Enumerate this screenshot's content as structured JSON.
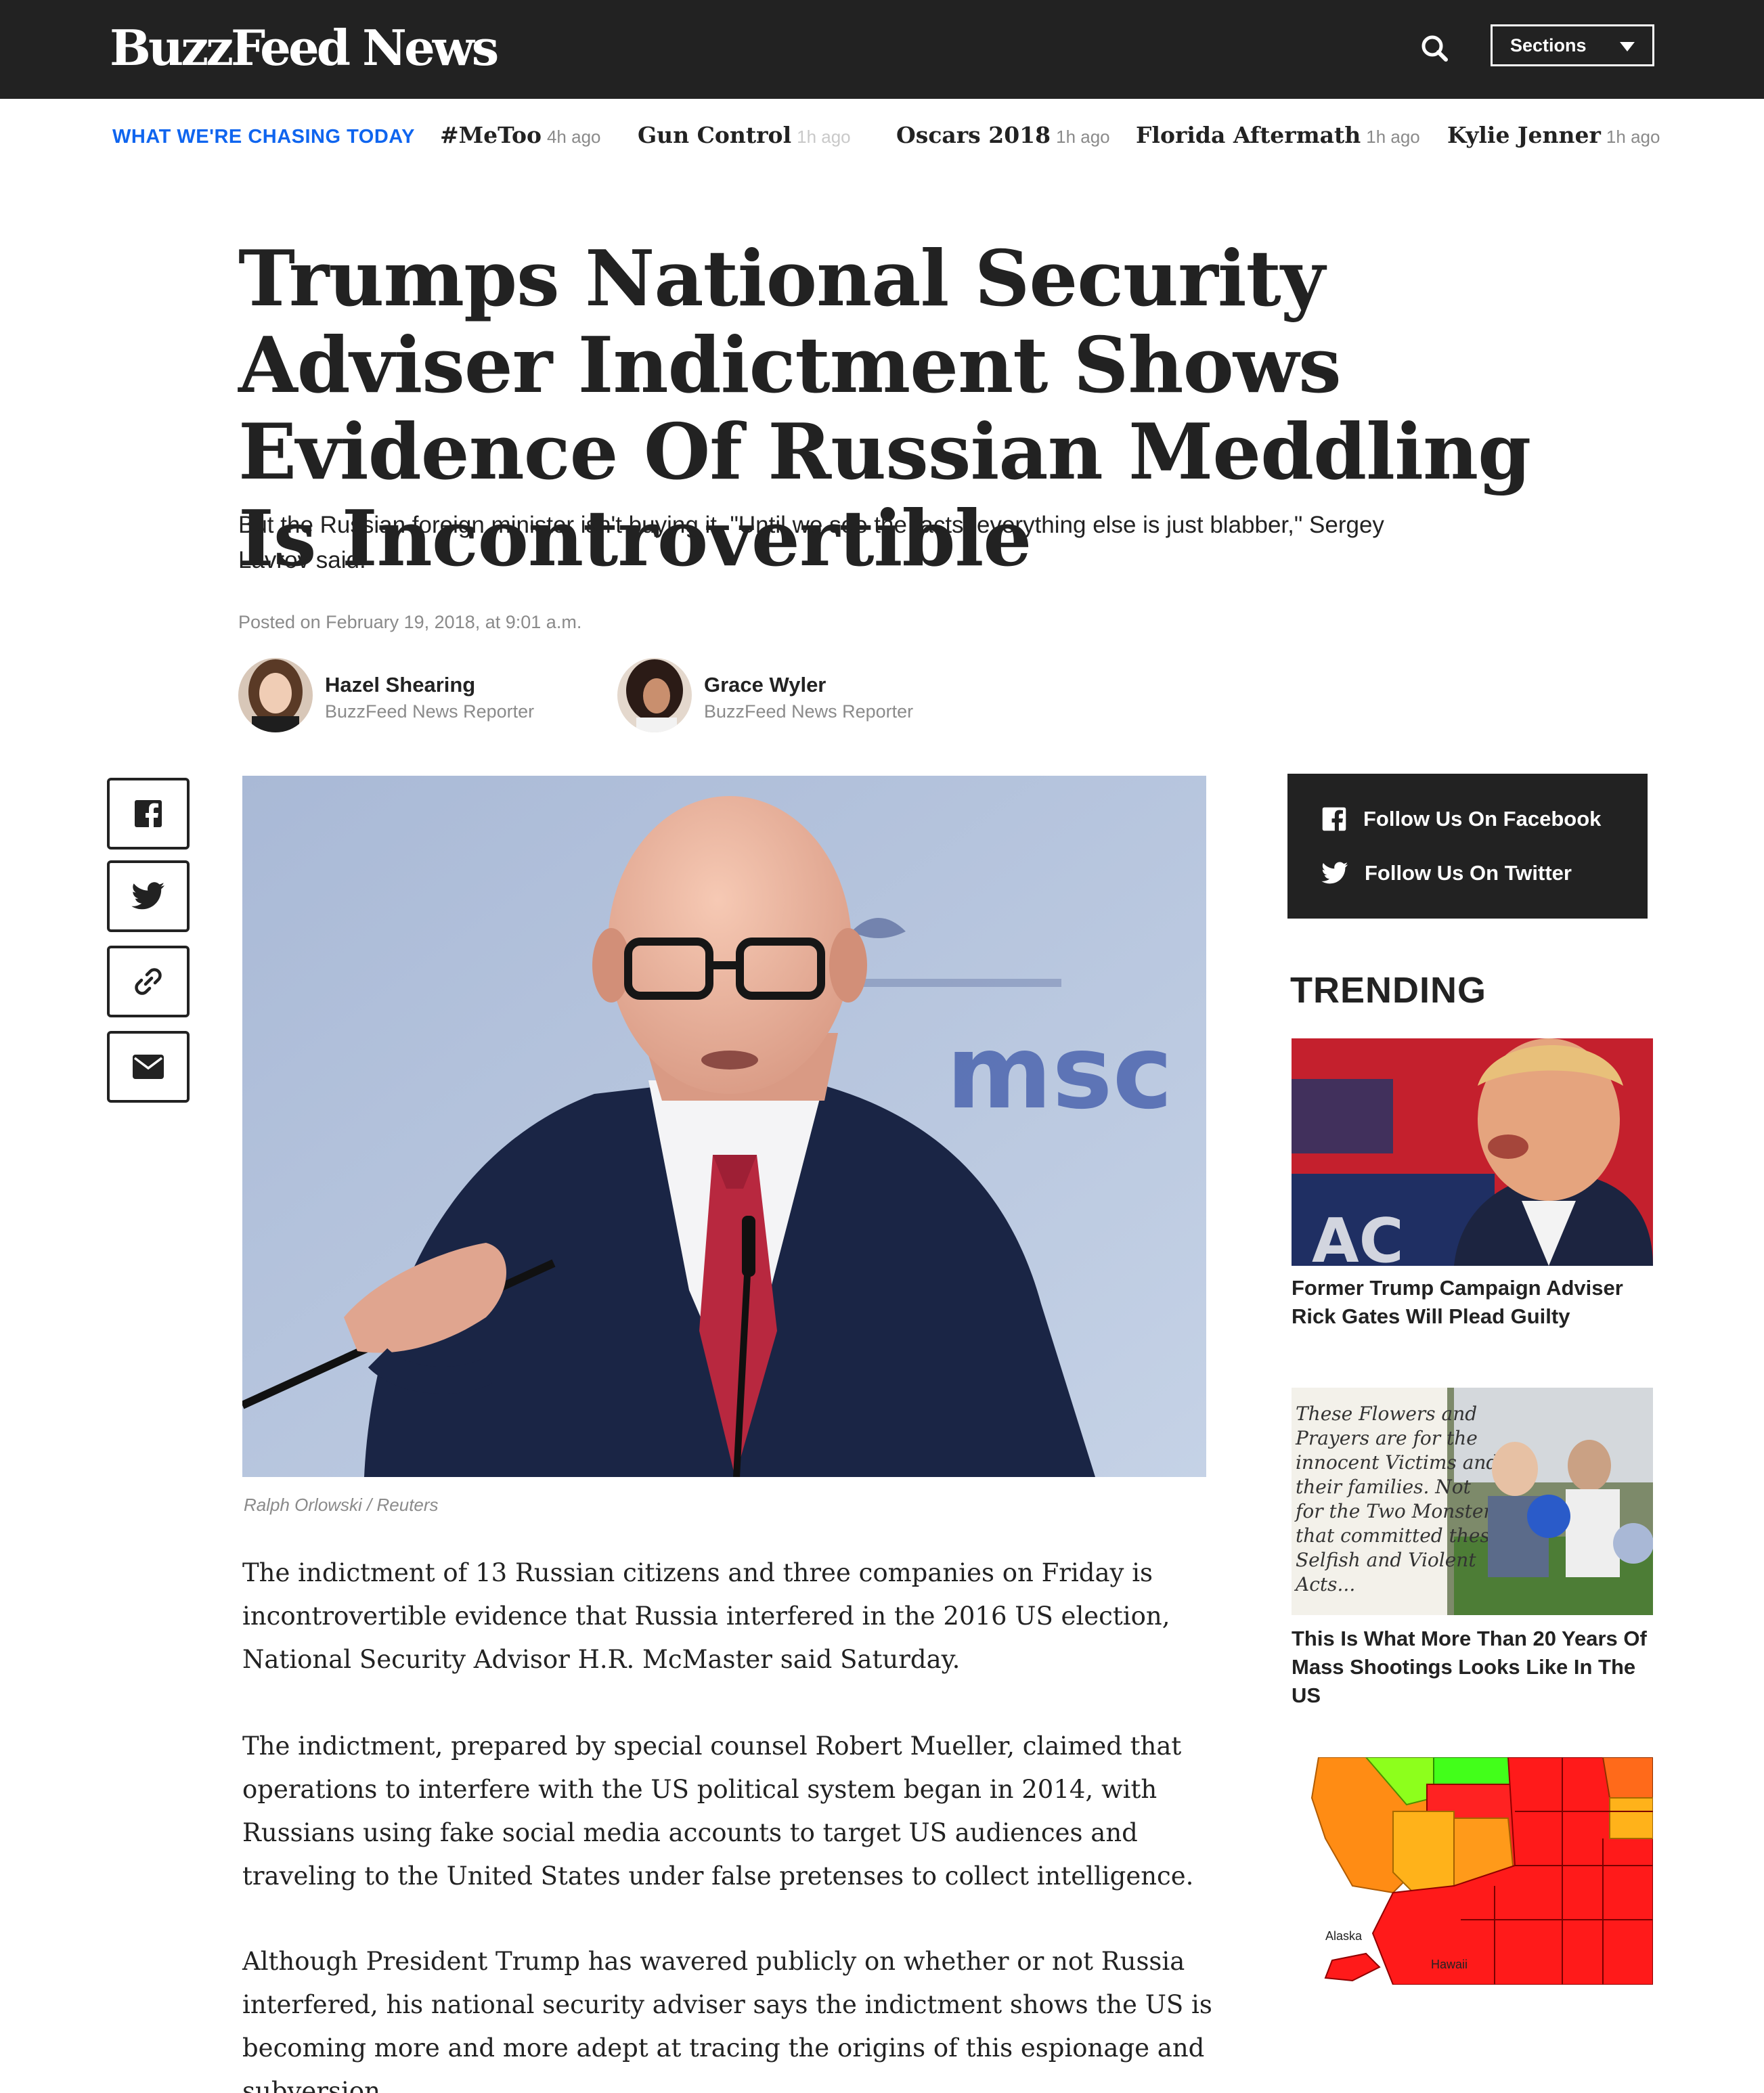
{
  "header": {
    "logo": "BuzzFeed News",
    "sections_label": "Sections"
  },
  "chasing": {
    "label": "WHAT WE'RE CHASING TODAY",
    "topics": [
      {
        "name": "#MeToo",
        "time": "4h ago"
      },
      {
        "name": "Gun Control",
        "time": "1h ago"
      },
      {
        "name": "Oscars 2018",
        "time": "1h ago"
      },
      {
        "name": "Florida Aftermath",
        "time": "1h ago"
      },
      {
        "name": "Kylie Jenner",
        "time": "1h ago"
      }
    ]
  },
  "article": {
    "headline": "Trumps National Security Adviser Indictment Shows Evidence Of Russian Meddling Is Incontrovertible",
    "dek": "But the Russian foreign minister isn't buying it. \"Until we see the facts, everything else is just blabber,\" Sergey Lavrov said.",
    "posted": "Posted on February 19, 2018, at 9:01 a.m.",
    "authors": [
      {
        "name": "Hazel Shearing",
        "role": "BuzzFeed News Reporter"
      },
      {
        "name": "Grace Wyler",
        "role": "BuzzFeed News Reporter"
      }
    ],
    "image_credit": "Ralph Orlowski / Reuters",
    "image_sign_text": "msc",
    "paragraphs": [
      "The indictment of 13 Russian citizens and three companies on Friday is incontrovertible evidence that Russia interfered in the 2016 US election, National Security Advisor H.R. McMaster said Saturday.",
      "The indictment, prepared by special counsel Robert Mueller, claimed that operations to interfere with the US political system began in 2014, with Russians using fake social media accounts to target US audiences and traveling to the United States under false pretenses to collect intelligence.",
      "Although President Trump has wavered publicly on whether or not Russia interfered, his national security adviser says the indictment shows the US is becoming more and more adept at tracing the origins of this espionage and subversion."
    ]
  },
  "share": {
    "icons": [
      "facebook-icon",
      "twitter-icon",
      "link-icon",
      "email-icon"
    ]
  },
  "sidebar": {
    "follow_facebook": "Follow Us On Facebook",
    "follow_twitter": "Follow Us On Twitter",
    "trending_title": "TRENDING",
    "trending": [
      {
        "title": "Former Trump Campaign Adviser Rick Gates Will Plead Guilty"
      },
      {
        "title": "This Is What More Than 20 Years Of Mass Shootings Looks Like In The US"
      },
      {
        "map_labels": [
          "Alaska",
          "Hawaii"
        ]
      }
    ]
  },
  "colors": {
    "header_bg": "#222222",
    "accent_blue": "#0f65ef",
    "muted_text": "#8a8a8a"
  }
}
